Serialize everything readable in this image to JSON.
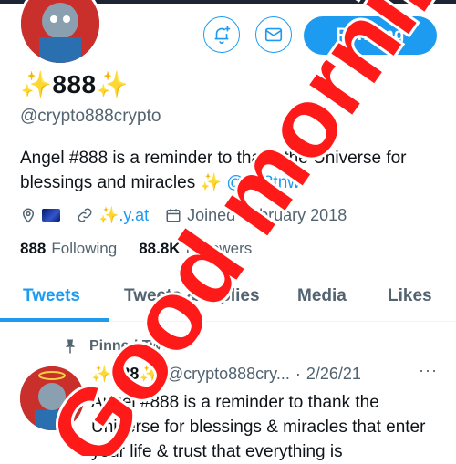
{
  "profile": {
    "display_name": "✨888✨",
    "handle": "@crypto888crypto",
    "bio_prefix": "Angel #888 is a reminder to thank the Universe for blessings and miracles ✨ ",
    "bio_link": "@888tnw",
    "website": "✨.y.at",
    "joined": "Joined February 2018",
    "following_count": "888",
    "following_label": "Following",
    "followers_count": "88.8K",
    "followers_label": "Followers"
  },
  "actions": {
    "notify_icon": "bell-plus-icon",
    "message_icon": "mail-icon",
    "follow_state_label": "Pending"
  },
  "tabs": [
    {
      "label": "Tweets"
    },
    {
      "label": "Tweets & replies"
    },
    {
      "label": "Media"
    },
    {
      "label": "Likes"
    }
  ],
  "pinned_tweet": {
    "pinned_label": "Pinned Tweet",
    "display_name": "✨888✨",
    "handle": "@crypto888cry...",
    "separator": "·",
    "date": "2/26/21",
    "more": "···",
    "text": "Angel #888 is a reminder to thank the Universe for blessings & miracles that enter your life & trust that everything is"
  },
  "overlay_text": "Good morning",
  "colors": {
    "accent": "#1d9bf0",
    "overlay_red": "#ff1a1a",
    "secondary_text": "#536471"
  }
}
